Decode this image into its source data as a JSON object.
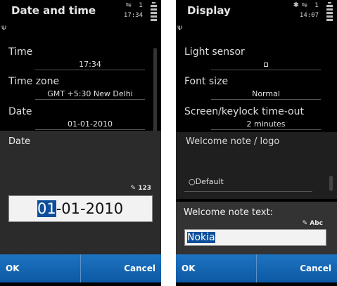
{
  "left": {
    "title": "Date and time",
    "clock": "17:34",
    "settings": [
      {
        "label": "Time",
        "value": "17:34"
      },
      {
        "label": "Time zone",
        "value": "GMT +5:30  New Delhi"
      },
      {
        "label": "Date",
        "value": "01-01-2010"
      }
    ],
    "dialog": {
      "title": "Date",
      "mode_indicator": "123",
      "value_selected": "01",
      "value_rest": "-01-2010"
    },
    "softkeys": {
      "left": "OK",
      "right": "Cancel"
    }
  },
  "right": {
    "title": "Display",
    "clock": "14:07",
    "settings": [
      {
        "label": "Light sensor"
      },
      {
        "label": "Font size",
        "value": "Normal"
      },
      {
        "label": "Screen/keylock time-out",
        "value": "2 minutes"
      }
    ],
    "welcome": {
      "title": "Welcome note / logo",
      "option": "Default"
    },
    "dialog": {
      "title": "Welcome note text:",
      "mode_indicator": "Abc",
      "value": "Nokia"
    },
    "softkeys": {
      "left": "OK",
      "right": "Cancel"
    }
  }
}
